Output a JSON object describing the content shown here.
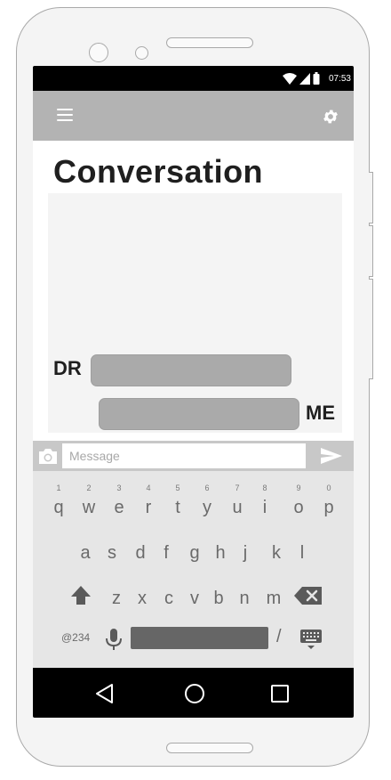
{
  "status_bar": {
    "time": "07:53"
  },
  "page": {
    "title": "Conversation"
  },
  "chat": {
    "messages": [
      {
        "sender_label": "DR"
      },
      {
        "sender_label": "ME"
      }
    ]
  },
  "composer": {
    "placeholder": "Message"
  },
  "keyboard": {
    "row1": [
      {
        "key": "q",
        "hint": "1"
      },
      {
        "key": "w",
        "hint": "2"
      },
      {
        "key": "e",
        "hint": "3"
      },
      {
        "key": "r",
        "hint": "4"
      },
      {
        "key": "t",
        "hint": "5"
      },
      {
        "key": "y",
        "hint": "6"
      },
      {
        "key": "u",
        "hint": "7"
      },
      {
        "key": "i",
        "hint": "8"
      },
      {
        "key": "o",
        "hint": "9"
      },
      {
        "key": "p",
        "hint": "0"
      }
    ],
    "row2": [
      "a",
      "s",
      "d",
      "f",
      "g",
      "h",
      "j",
      "k",
      "l"
    ],
    "row3": [
      "z",
      "x",
      "c",
      "v",
      "b",
      "n",
      "m"
    ],
    "symbols_label": "@234",
    "slash_label": "/"
  },
  "icons": {
    "menu": "menu-icon",
    "settings": "gear-icon",
    "camera": "camera-icon",
    "send": "send-icon",
    "shift": "shift-arrow-icon",
    "delete": "backspace-icon",
    "mic": "microphone-icon",
    "keyboard": "keyboard-icon",
    "back": "triangle-back-icon",
    "home": "circle-home-icon",
    "recents": "square-recents-icon"
  },
  "colors": {
    "app_bar": "#b3b3b3",
    "bubble": "#aaaaaa",
    "chat_background": "#f4f4f4",
    "keyboard_background": "#e6e6e6",
    "system_bars": "#000000"
  }
}
